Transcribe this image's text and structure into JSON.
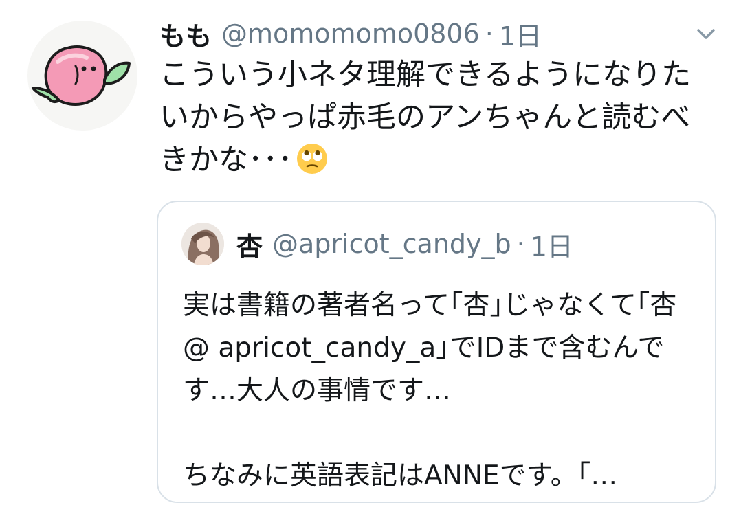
{
  "tweet": {
    "display_name": "もも",
    "handle": "@momomomo0806",
    "separator": "·",
    "time": "1日",
    "text": "こういう小ネタ理解できるようになりたいからやっぱ赤毛のアンちゃんと読むべきかな･･･",
    "emoji": "face-with-rolling-eyes"
  },
  "quoted_tweet": {
    "display_name": "杏",
    "handle": "@apricot_candy_b",
    "separator": "·",
    "time": "1日",
    "text": "実は書籍の著者名って｢杏｣じゃなくて｢杏 @ apricot_candy_a｣でIDまで含むんです…大人の事情です…\n\nちなみに英語表記はANNEです。｢…"
  },
  "colors": {
    "text": "#14171a",
    "secondary": "#657786",
    "border": "#d9e1e8"
  }
}
